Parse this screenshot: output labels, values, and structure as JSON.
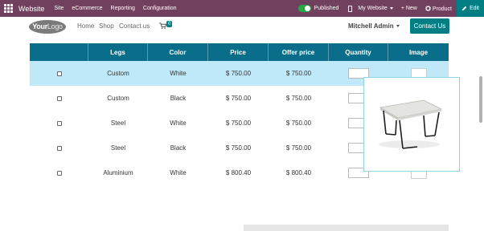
{
  "topbar": {
    "brand": "Website",
    "menu": [
      "Site",
      "eCommerce",
      "Reporting",
      "Configuration"
    ],
    "published_label": "Published",
    "site_selector": "My Website",
    "new_label": "+ New",
    "product_label": "Product",
    "edit_label": "Edit"
  },
  "header": {
    "logo_text_a": "Your",
    "logo_text_b": "Logo",
    "nav": [
      "Home",
      "Shop",
      "Contact us"
    ],
    "cart_count": "0",
    "user_name": "Mitchell Admin",
    "contact_button": "Contact Us"
  },
  "table": {
    "columns": [
      "",
      "Legs",
      "Color",
      "Price",
      "Offer price",
      "Quantity",
      "Image"
    ],
    "rows": [
      {
        "legs": "Custom",
        "color": "White",
        "price": "$ 750.00",
        "offer": "$ 750.00"
      },
      {
        "legs": "Custom",
        "color": "Black",
        "price": "$ 750.00",
        "offer": "$ 750.00"
      },
      {
        "legs": "Steel",
        "color": "White",
        "price": "$ 750.00",
        "offer": "$ 750.00"
      },
      {
        "legs": "Steel",
        "color": "Black",
        "price": "$ 750.00",
        "offer": "$ 750.00"
      },
      {
        "legs": "Aluminium",
        "color": "White",
        "price": "$ 800.40",
        "offer": "$ 800.40"
      }
    ]
  },
  "colors": {
    "topbar": "#71405f",
    "accent": "#017e84",
    "table_header": "#0a6e8a",
    "selected_row": "#bfe9f8"
  },
  "icons": [
    "apps-grid-icon",
    "mobile-icon",
    "gear-icon",
    "pencil-icon",
    "cart-icon",
    "table-product-image"
  ]
}
